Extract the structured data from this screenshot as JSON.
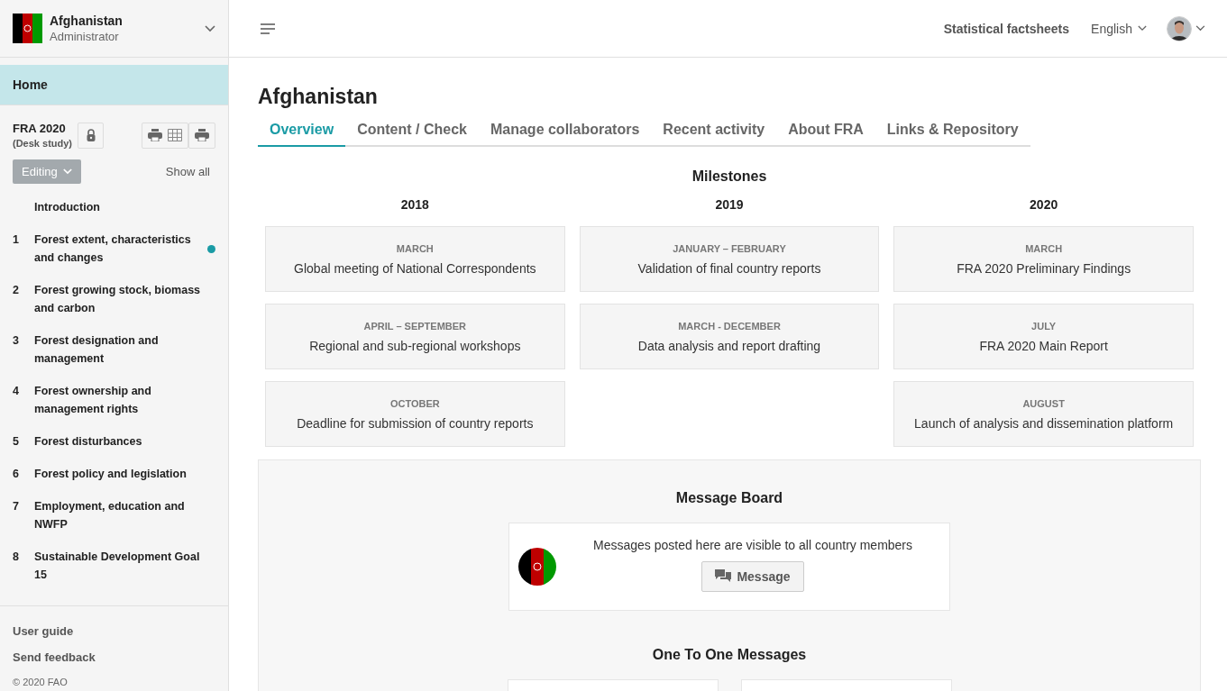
{
  "country": {
    "name": "Afghanistan",
    "role": "Administrator"
  },
  "sidebar": {
    "home": {
      "label": "Home",
      "selected": true
    },
    "assessment": {
      "title": "FRA 2020",
      "subtitle": "(Desk study)",
      "status": "Editing",
      "show_all": "Show all"
    },
    "items": [
      {
        "label": "Introduction",
        "notification": false
      },
      {
        "number": "1",
        "label": "Forest extent, characteristics and changes",
        "notification": true
      },
      {
        "number": "2",
        "label": "Forest growing stock, biomass and carbon",
        "notification": false
      },
      {
        "number": "3",
        "label": "Forest designation and management",
        "notification": false
      },
      {
        "number": "4",
        "label": "Forest ownership and management rights",
        "notification": false
      },
      {
        "number": "5",
        "label": "Forest disturbances",
        "notification": false
      },
      {
        "number": "6",
        "label": "Forest policy and legislation",
        "notification": false
      },
      {
        "number": "7",
        "label": "Employment, education and NWFP",
        "notification": false
      },
      {
        "number": "8",
        "label": "Sustainable Development Goal 15",
        "notification": false
      }
    ],
    "footer_links": [
      "User guide",
      "Send feedback"
    ],
    "copyright": "© 2020 FAO"
  },
  "header": {
    "factsheets": "Statistical factsheets",
    "language": "English"
  },
  "page_title": "Afghanistan",
  "tabs": [
    {
      "label": "Overview",
      "selected": true
    },
    {
      "label": "Content / Check",
      "selected": false
    },
    {
      "label": "Manage collaborators",
      "selected": false
    },
    {
      "label": "Recent activity",
      "selected": false
    },
    {
      "label": "About FRA",
      "selected": false
    },
    {
      "label": "Links & Repository",
      "selected": false
    }
  ],
  "milestones": {
    "title": "Milestones",
    "years": [
      {
        "year": "2018",
        "items": [
          {
            "period": "MARCH",
            "text": "Global meeting of National Correspondents"
          },
          {
            "period": "APRIL – SEPTEMBER",
            "text": "Regional and sub-regional workshops"
          },
          {
            "period": "OCTOBER",
            "text": "Deadline for submission of country reports"
          }
        ]
      },
      {
        "year": "2019",
        "items": [
          {
            "period": "JANUARY – FEBRUARY",
            "text": "Validation of final country reports"
          },
          {
            "period": "MARCH - DECEMBER",
            "text": "Data analysis and report drafting"
          }
        ]
      },
      {
        "year": "2020",
        "items": [
          {
            "period": "MARCH",
            "text": "FRA 2020 Preliminary Findings"
          },
          {
            "period": "JULY",
            "text": "FRA 2020 Main Report"
          },
          {
            "period": "AUGUST",
            "text": "Launch of analysis and dissemination platform"
          }
        ]
      }
    ]
  },
  "message_board": {
    "title": "Message Board",
    "info": "Messages posted here are visible to all country members",
    "button": "Message"
  },
  "one_to_one": {
    "title": "One To One Messages"
  }
}
